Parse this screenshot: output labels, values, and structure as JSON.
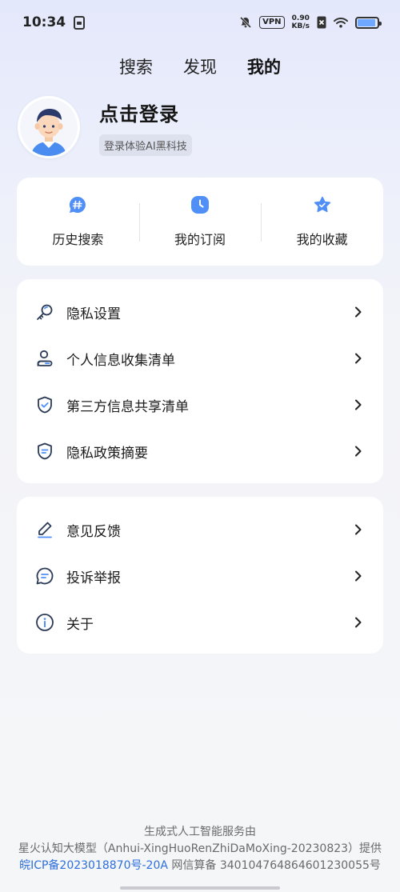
{
  "status_bar": {
    "time": "10:34",
    "vpn": "VPN",
    "speed_value": "0.90",
    "speed_unit": "KB/s",
    "battery_level": 0.9,
    "accent": "#6ea8ff"
  },
  "tabs": [
    {
      "label": "搜索",
      "active": false
    },
    {
      "label": "发现",
      "active": false
    },
    {
      "label": "我的",
      "active": true
    }
  ],
  "profile": {
    "title": "点击登录",
    "subtitle": "登录体验AI黑科技",
    "avatar_icon": "avatar-boy-icon"
  },
  "quick_actions": [
    {
      "label": "历史搜索",
      "icon": "hashtag-bubble-icon"
    },
    {
      "label": "我的订阅",
      "icon": "clock-icon"
    },
    {
      "label": "我的收藏",
      "icon": "star-icon"
    }
  ],
  "privacy_menu": [
    {
      "label": "隐私设置",
      "icon": "magnifier-key-icon"
    },
    {
      "label": "个人信息收集清单",
      "icon": "person-list-icon"
    },
    {
      "label": "第三方信息共享清单",
      "icon": "shield-check-icon"
    },
    {
      "label": "隐私政策摘要",
      "icon": "shield-lines-icon"
    }
  ],
  "support_menu": [
    {
      "label": "意见反馈",
      "icon": "pencil-icon"
    },
    {
      "label": "投诉举报",
      "icon": "message-icon"
    },
    {
      "label": "关于",
      "icon": "info-icon"
    }
  ],
  "footer": {
    "line1": "生成式人工智能服务由",
    "line2": "星火认知大模型（Anhui-XingHuoRenZhiDaMoXing-20230823）提供",
    "icp": "皖ICP备2023018870号-20A",
    "filing": " 网信算备 340104764864601230055号"
  },
  "colors": {
    "icon_blue": "#4f8ff7",
    "icon_dark": "#2b3a55"
  }
}
